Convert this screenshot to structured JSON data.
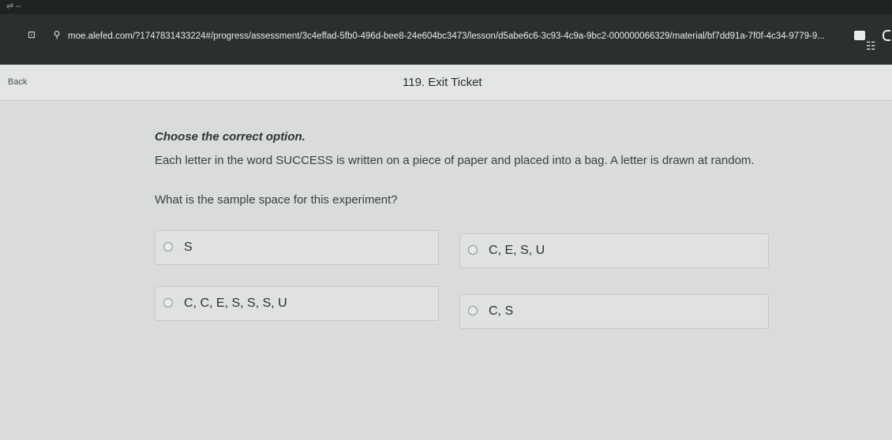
{
  "browser": {
    "url": "moe.alefed.com/?1747831433224#/progress/assessment/3c4effad-5fb0-496d-bee8-24e604bc3473/lesson/d5abe6c6-3c93-4c9a-9bc2-000000066329/material/bf7dd91a-7f0f-4c34-9779-9..."
  },
  "header": {
    "back_label": "Back",
    "title": "119. Exit Ticket"
  },
  "question": {
    "instruction": "Choose the correct option.",
    "stem": "Each letter in the word SUCCESS is written on a piece of paper and placed into a bag. A letter is drawn at random.",
    "prompt": "What is the sample space for this experiment?"
  },
  "options": [
    {
      "label": "S"
    },
    {
      "label": "C, E, S, U"
    },
    {
      "label": "C, C, E, S, S, S, U"
    },
    {
      "label": "C, S"
    }
  ]
}
